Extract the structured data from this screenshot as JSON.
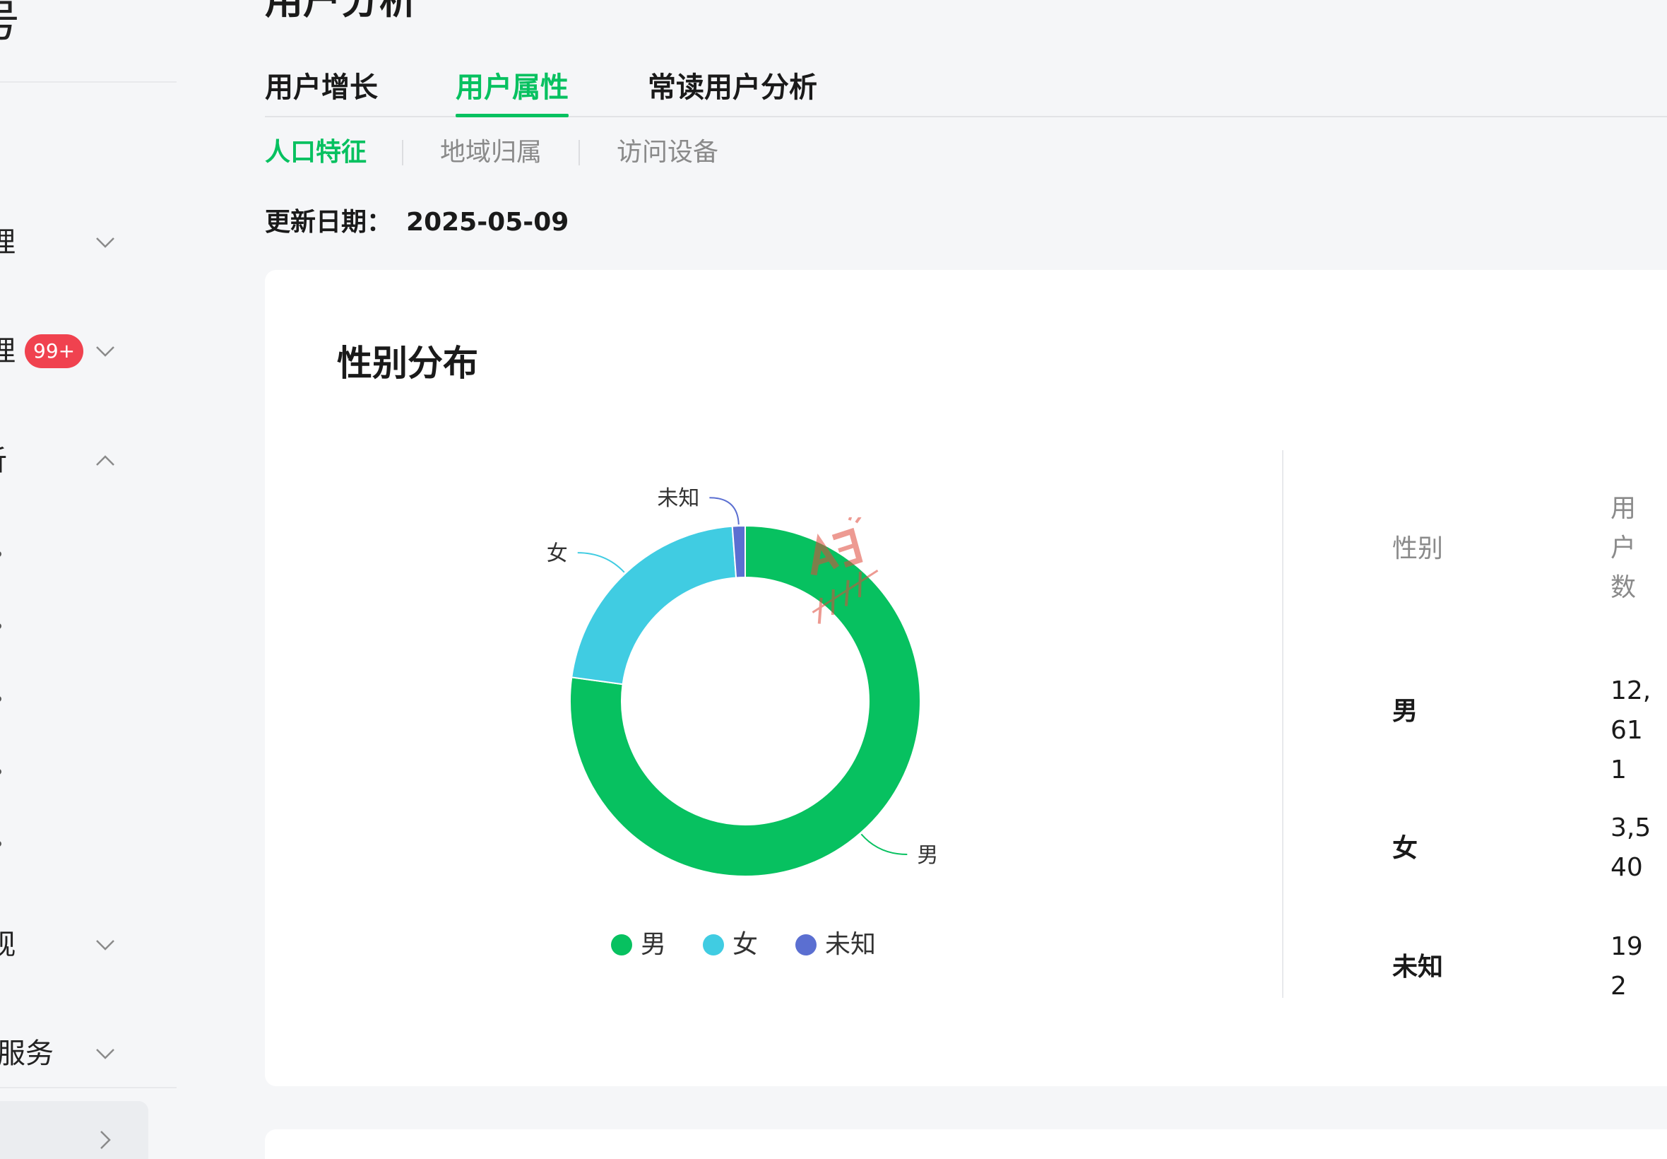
{
  "sidebar": {
    "title": "号",
    "items": [
      {
        "label": "理",
        "expanded": false
      },
      {
        "label": "理",
        "badge": "99+",
        "expanded": false
      },
      {
        "label": "析",
        "expanded": true
      },
      {
        "label": "观",
        "expanded": false
      },
      {
        "label": "服务",
        "expanded": false
      }
    ]
  },
  "page": {
    "title": "用户分析"
  },
  "tabs": [
    "用户增长",
    "用户属性",
    "常读用户分析"
  ],
  "active_tab": "用户属性",
  "subtabs": [
    "人口特征",
    "地域归属",
    "访问设备"
  ],
  "active_subtab": "人口特征",
  "update": {
    "label": "更新日期：",
    "value": "2025-05-09"
  },
  "gender_card": {
    "title": "性别分布",
    "table_headers": {
      "category": "性别",
      "value": "用户数"
    },
    "rows": [
      {
        "label": "男",
        "value": "12,611"
      },
      {
        "label": "女",
        "value": "3,540"
      },
      {
        "label": "未知",
        "value": "192"
      }
    ]
  },
  "chart_data": {
    "type": "pie",
    "donut": true,
    "categories": [
      "男",
      "女",
      "未知"
    ],
    "values": [
      12611,
      3540,
      192
    ],
    "colors": [
      "#07c160",
      "#40cce2",
      "#5b6fd1"
    ],
    "title": "性别分布",
    "legend": "bottom",
    "slice_labels": [
      "男",
      "女",
      "未知"
    ]
  }
}
